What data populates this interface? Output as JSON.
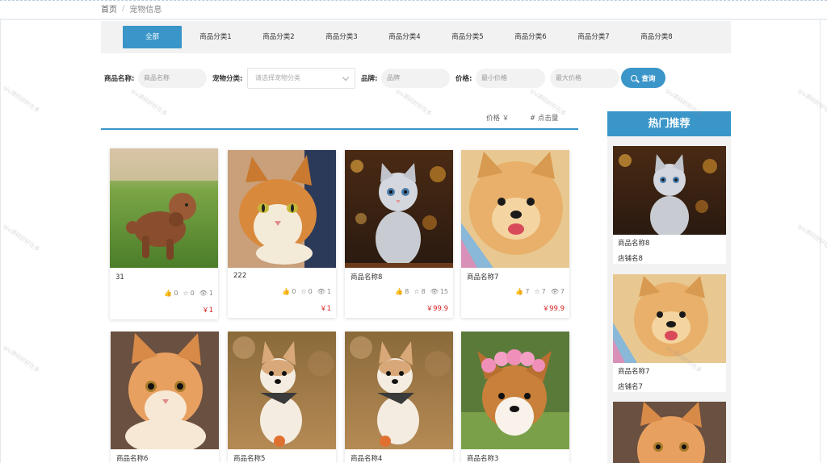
{
  "breadcrumb": {
    "home": "首页",
    "separator": "/",
    "current": "宠物信息"
  },
  "categories": [
    "全部",
    "商品分类1",
    "商品分类2",
    "商品分类3",
    "商品分类4",
    "商品分类5",
    "商品分类6",
    "商品分类7",
    "商品分类8"
  ],
  "active_category": "全部",
  "search": {
    "name_label": "商品名称:",
    "name_placeholder": "商品名称",
    "type_label": "宠物分类:",
    "type_placeholder": "请选择宠物分类",
    "brand_label": "品牌:",
    "brand_placeholder": "品牌",
    "price_label": "价格:",
    "min_price_placeholder": "最小价格",
    "max_price_placeholder": "最大价格",
    "button_label": "查询"
  },
  "sort": {
    "price_label": "价格 ￥",
    "clicks_label": "# 点击量"
  },
  "products": [
    {
      "name": "31",
      "likes": "0",
      "favorites": "0",
      "views": "1",
      "price": "￥1",
      "photo": "brown-poodle-on-grass"
    },
    {
      "name": "222",
      "likes": "0",
      "favorites": "0",
      "views": "1",
      "price": "￥1",
      "photo": "orange-tabby-cat"
    },
    {
      "name": "商品名称8",
      "likes": "8",
      "favorites": "8",
      "views": "15",
      "price": "￥99.9",
      "photo": "grey-kitten-bokeh"
    },
    {
      "name": "商品名称7",
      "likes": "7",
      "favorites": "7",
      "views": "7",
      "price": "￥99.9",
      "photo": "pomeranian-dog"
    },
    {
      "name": "商品名称6",
      "photo": "ginger-white-cat"
    },
    {
      "name": "商品名称5",
      "photo": "shiba-puppy-scarf"
    },
    {
      "name": "商品名称4",
      "photo": "shiba-puppy-scarf"
    },
    {
      "name": "商品名称3",
      "photo": "corgi-flower-crown"
    }
  ],
  "hot": {
    "title": "热门推荐",
    "items": [
      {
        "name": "商品名称8",
        "shop": "店铺名8",
        "photo": "grey-kitten-bokeh"
      },
      {
        "name": "商品名称7",
        "shop": "店铺名7",
        "photo": "pomeranian-dog"
      },
      {
        "photo": "ginger-white-cat"
      }
    ]
  },
  "watermark_text": "qiu源码好好在多",
  "colors": {
    "accent": "#3a95c9",
    "price": "#d82020",
    "tab_bg": "#f2f2f2"
  }
}
